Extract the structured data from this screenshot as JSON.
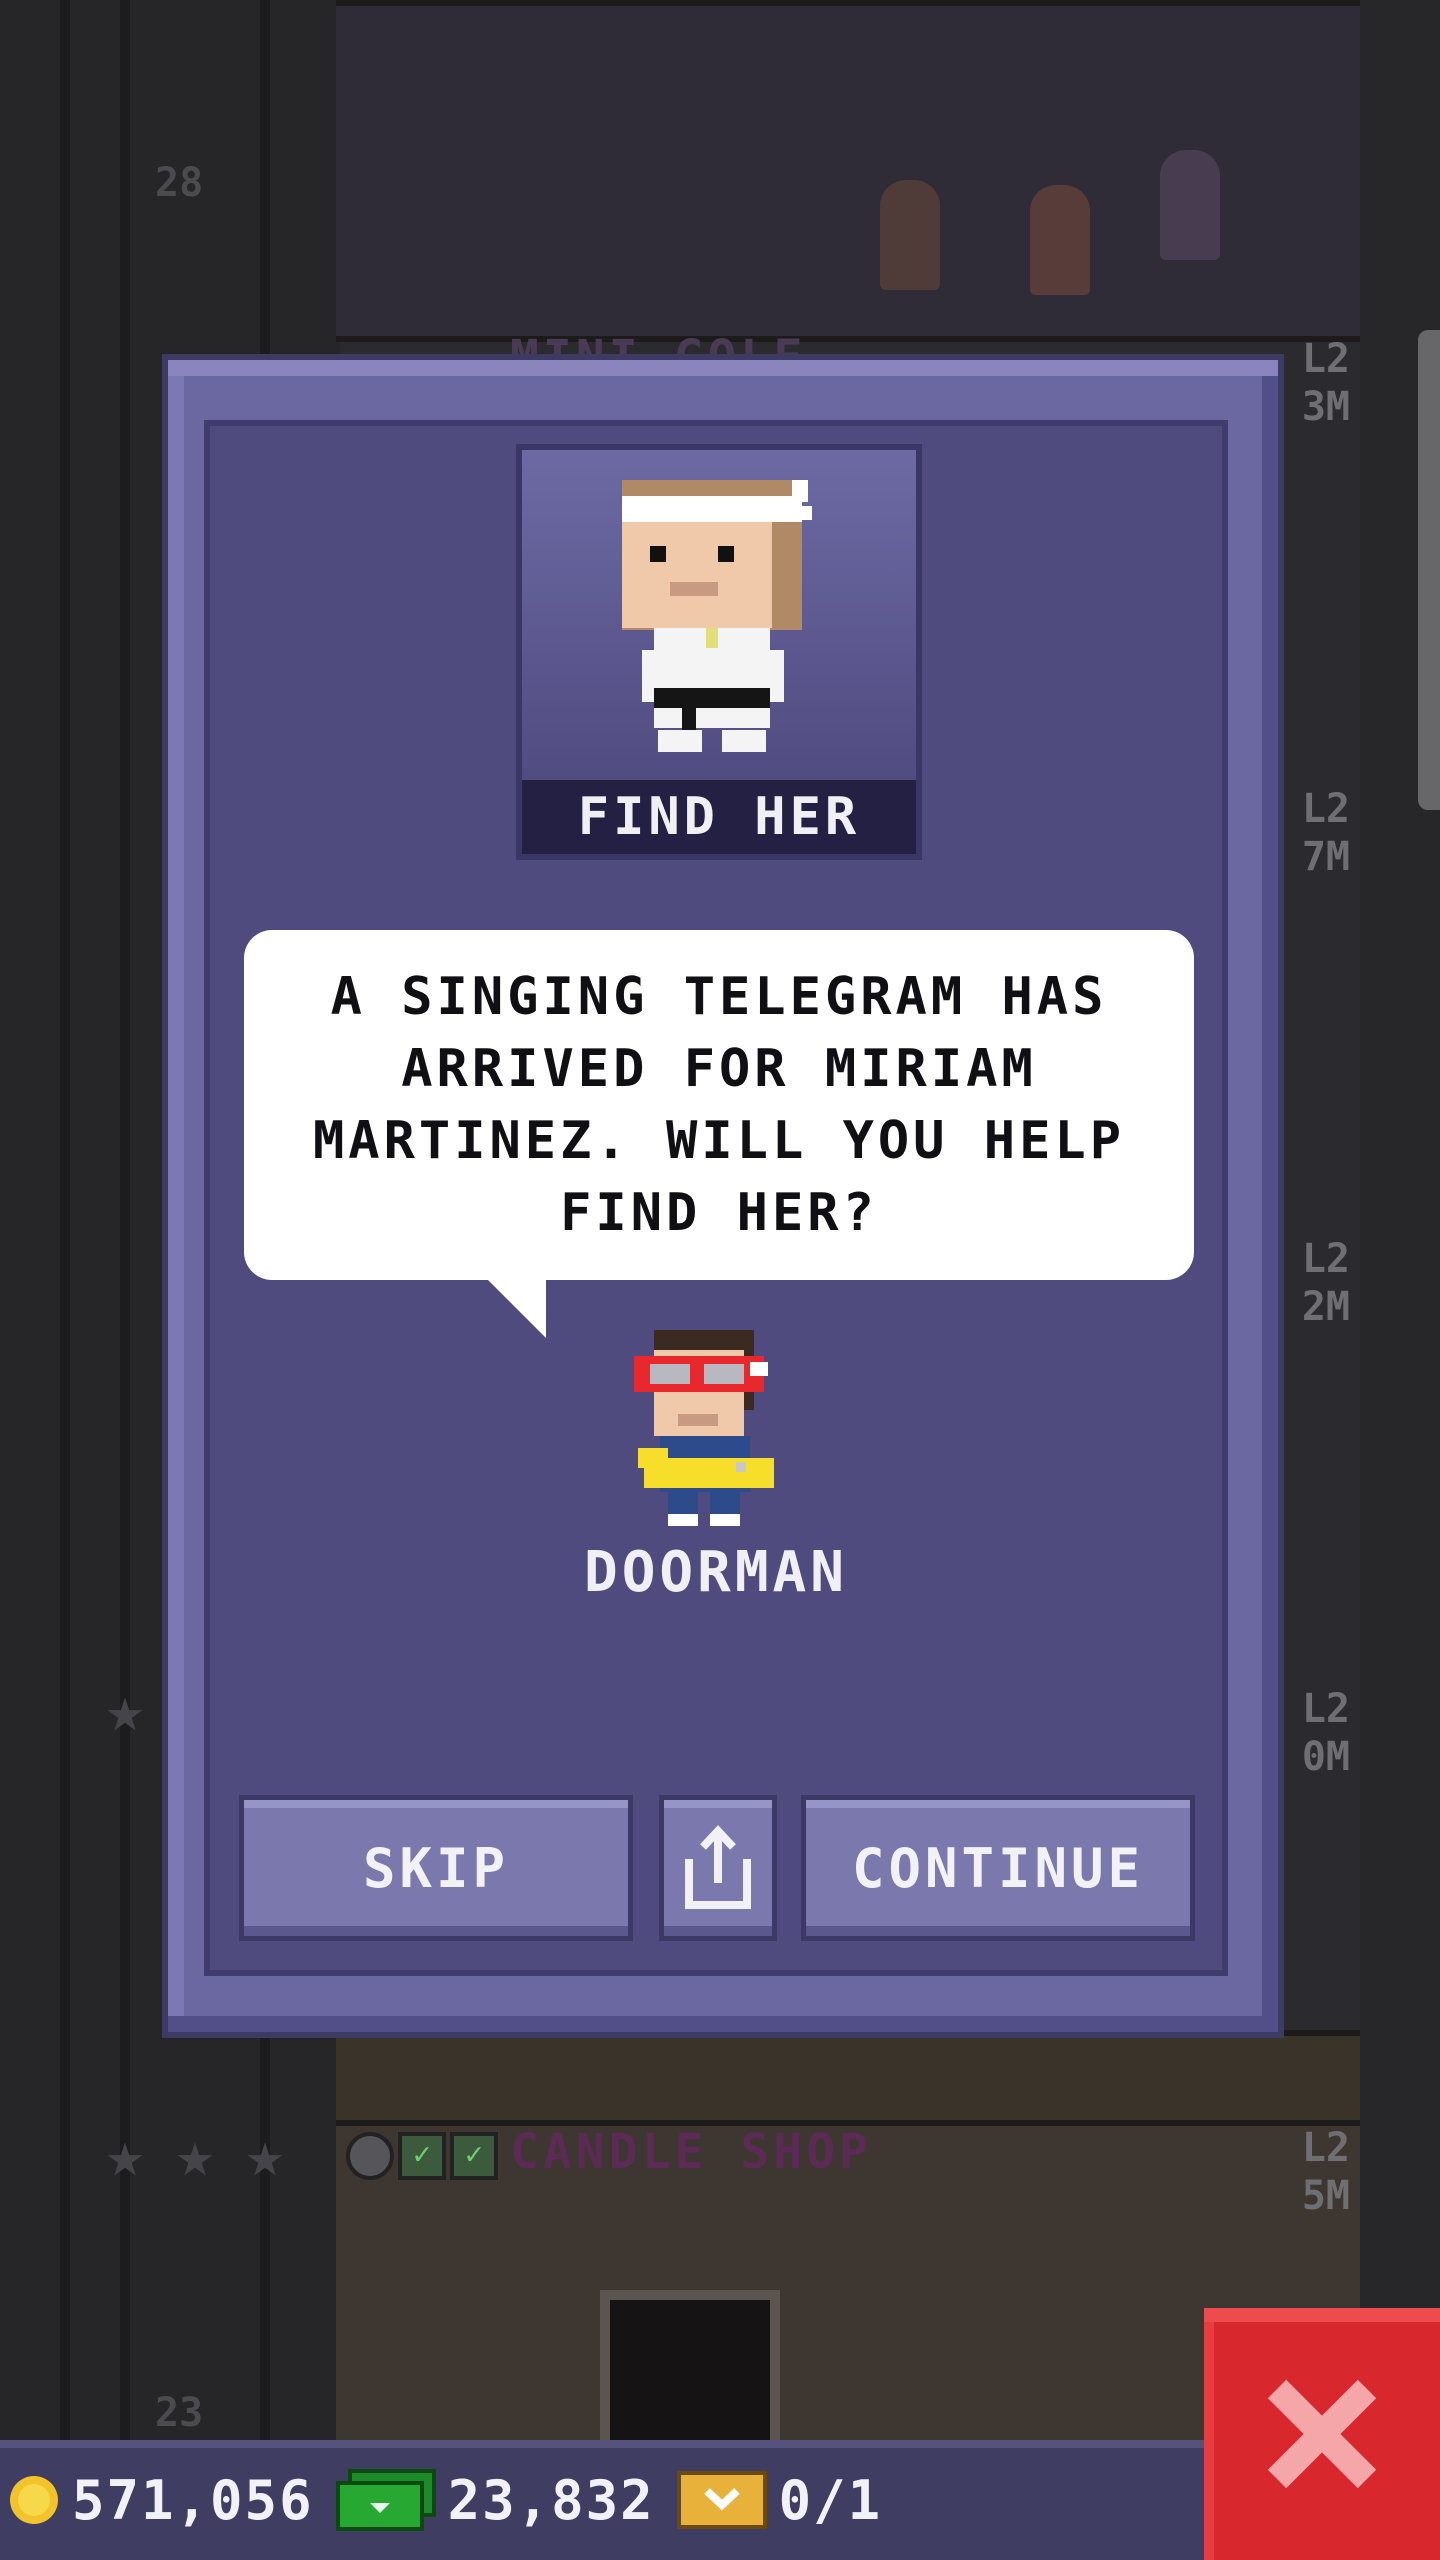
{
  "background": {
    "floor_numbers": [
      "28",
      "23"
    ],
    "floors": [
      {
        "name": "MINI GOLF",
        "level": "L2",
        "stock": "3M"
      },
      {
        "name": "",
        "level": "L2",
        "stock": "7M"
      },
      {
        "name": "",
        "level": "L2",
        "stock": "2M"
      },
      {
        "name": "",
        "level": "L2",
        "stock": "0M"
      },
      {
        "name": "CANDLE SHOP",
        "level": "L2",
        "stock": "5M"
      }
    ]
  },
  "dialog": {
    "portrait_caption": "FIND HER",
    "message": "A SINGING TELEGRAM HAS ARRIVED FOR MIRIAM MARTINEZ. WILL YOU HELP FIND HER?",
    "npc_name": "DOORMAN",
    "buttons": {
      "skip": "SKIP",
      "continue": "CONTINUE",
      "share_icon": "share-icon"
    }
  },
  "hud": {
    "coins": "571,056",
    "bux": "23,832",
    "tickets": "0/1",
    "close_icon": "close-icon"
  },
  "colors": {
    "dialog": "#6b67a0",
    "dialog_inner": "#4f4b7f",
    "button": "#7b78ae",
    "close": "#d8282e"
  }
}
